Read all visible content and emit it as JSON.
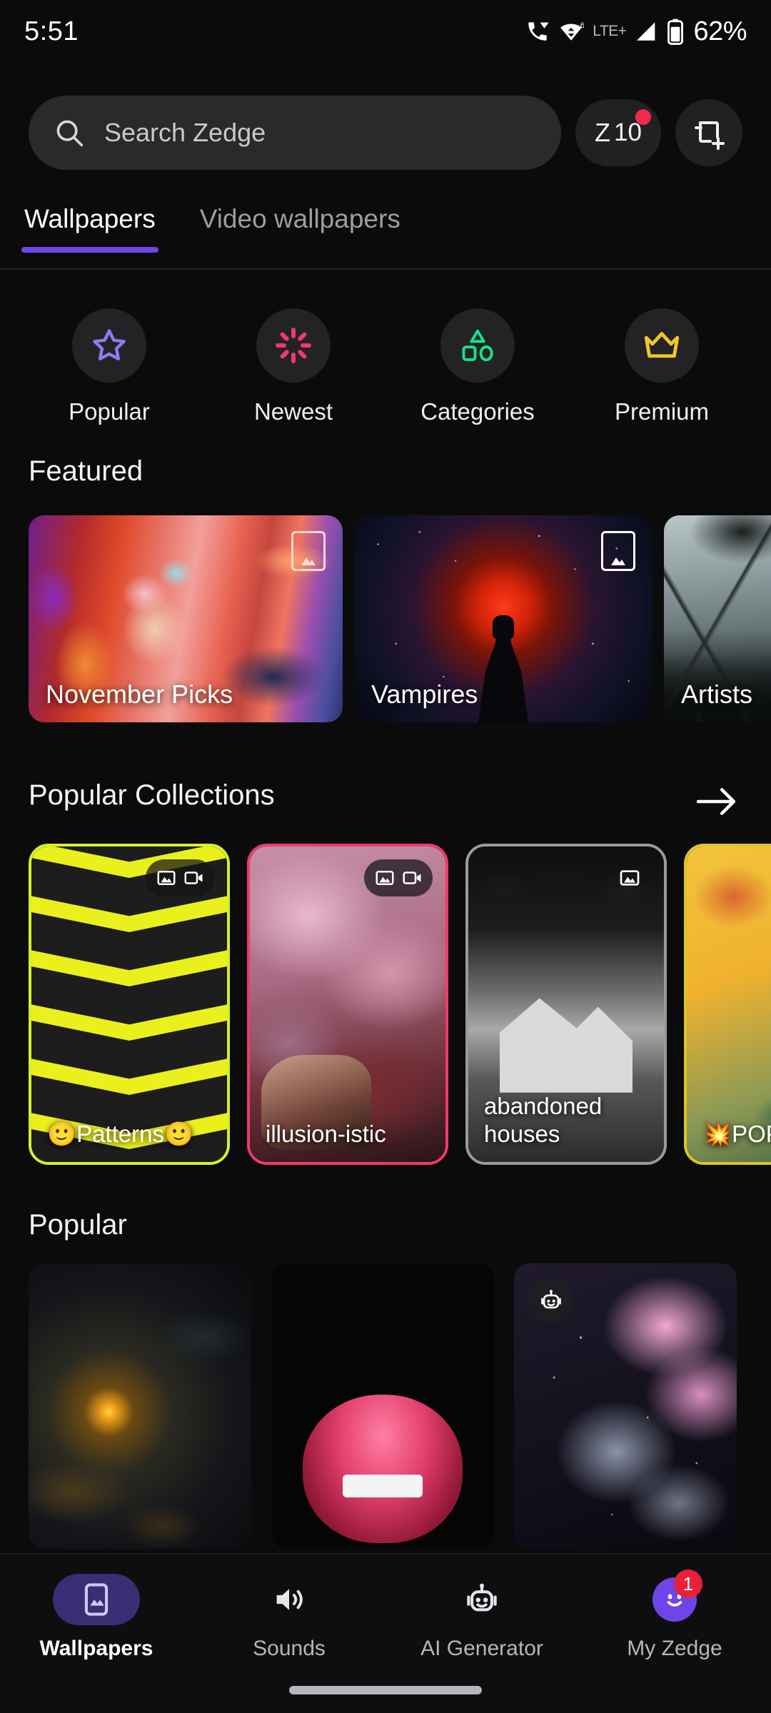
{
  "status_bar": {
    "time": "5:51",
    "network_label": "LTE+",
    "battery_percent": "62%",
    "icons": [
      "phone-wifi-calling-icon",
      "wifi-6-data-icon",
      "signal-bars-icon",
      "battery-icon"
    ]
  },
  "search": {
    "placeholder": "Search Zedge",
    "value": "",
    "icon": "search-icon",
    "credits": {
      "symbol": "Z",
      "amount": "10",
      "has_badge": true
    },
    "add_button_icon": "add-wallpaper-icon"
  },
  "tabs": [
    {
      "label": "Wallpapers",
      "active": true
    },
    {
      "label": "Video wallpapers",
      "active": false
    }
  ],
  "quick_links": [
    {
      "label": "Popular",
      "icon": "star-icon",
      "color": "#8f7bf0"
    },
    {
      "label": "Newest",
      "icon": "sparkle-burst-icon",
      "color": "#ef3a6a"
    },
    {
      "label": "Categories",
      "icon": "shapes-icon",
      "color": "#19e08a"
    },
    {
      "label": "Premium",
      "icon": "crown-icon",
      "color": "#f2c62a"
    }
  ],
  "featured": {
    "title": "Featured",
    "cards": [
      {
        "label": "November Picks",
        "badge": "image-icon"
      },
      {
        "label": "Vampires",
        "badge": "image-icon"
      },
      {
        "label": "Artists",
        "badge": ""
      }
    ]
  },
  "collections": {
    "title": "Popular Collections",
    "arrow_icon": "arrow-right-icon",
    "cards": [
      {
        "label": "🙂Patterns🙂",
        "badges": [
          "image-icon",
          "video-icon"
        ],
        "border": "#d8ef2a"
      },
      {
        "label": "illusion-istic",
        "badges": [
          "image-icon",
          "video-icon"
        ],
        "border": "#ef3a6a"
      },
      {
        "label": "abandoned houses",
        "badges": [
          "image-icon"
        ],
        "border": "#9a9a9c"
      },
      {
        "label": "💥POP",
        "badges": [],
        "border": "#d8c52a"
      }
    ]
  },
  "popular": {
    "title": "Popular",
    "items": [
      {
        "badge": ""
      },
      {
        "badge": ""
      },
      {
        "badge": "ai-robot-icon"
      }
    ]
  },
  "bottom_nav": [
    {
      "label": "Wallpapers",
      "icon": "wallpaper-icon",
      "active": true,
      "badge": ""
    },
    {
      "label": "Sounds",
      "icon": "speaker-icon",
      "active": false,
      "badge": ""
    },
    {
      "label": "AI Generator",
      "icon": "ai-robot-icon",
      "active": false,
      "badge": ""
    },
    {
      "label": "My Zedge",
      "icon": "avatar-smiley-icon",
      "active": false,
      "badge": "1"
    }
  ],
  "theme": {
    "accent": "#6f45e8",
    "background": "#0b0b0c",
    "badge_red": "#e8203c"
  }
}
